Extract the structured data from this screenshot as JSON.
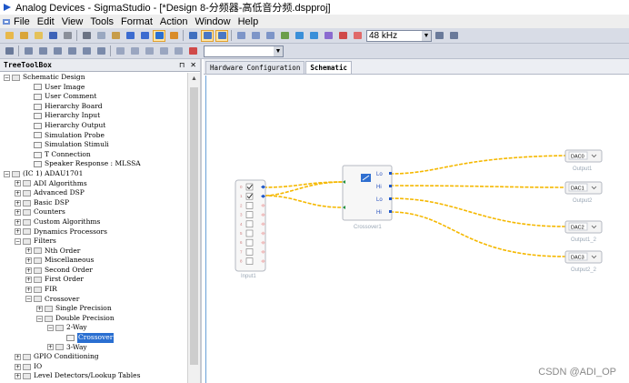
{
  "window": {
    "title": "Analog Devices - SigmaStudio - [*Design 8-分频器-高低音分频.dspproj]"
  },
  "menu": [
    "File",
    "Edit",
    "View",
    "Tools",
    "Format",
    "Action",
    "Window",
    "Help"
  ],
  "toolbar": {
    "sample_rate": "48 kHz"
  },
  "tree_panel": {
    "title": "TreeToolBox",
    "pin_icon": "⊓",
    "close_icon": "✕",
    "items": [
      {
        "label": "Schematic Design",
        "indent": 0,
        "exp": "−",
        "icon": "folder"
      },
      {
        "label": "User Image",
        "indent": 2,
        "exp": "",
        "icon": "item"
      },
      {
        "label": "User Comment",
        "indent": 2,
        "exp": "",
        "icon": "item"
      },
      {
        "label": "Hierarchy Board",
        "indent": 2,
        "exp": "",
        "icon": "item"
      },
      {
        "label": "Hierarchy Input",
        "indent": 2,
        "exp": "",
        "icon": "item"
      },
      {
        "label": "Hierarchy Output",
        "indent": 2,
        "exp": "",
        "icon": "item"
      },
      {
        "label": "Simulation Probe",
        "indent": 2,
        "exp": "",
        "icon": "item"
      },
      {
        "label": "Simulation Stimuli",
        "indent": 2,
        "exp": "",
        "icon": "item"
      },
      {
        "label": "T Connection",
        "indent": 2,
        "exp": "",
        "icon": "item"
      },
      {
        "label": "Speaker Response : MLSSA",
        "indent": 2,
        "exp": "",
        "icon": "item"
      },
      {
        "label": "(IC 1) ADAU1701",
        "indent": 0,
        "exp": "−",
        "icon": "folder"
      },
      {
        "label": "ADI Algorithms",
        "indent": 1,
        "exp": "+",
        "icon": "folder"
      },
      {
        "label": "Advanced DSP",
        "indent": 1,
        "exp": "+",
        "icon": "folder"
      },
      {
        "label": "Basic DSP",
        "indent": 1,
        "exp": "+",
        "icon": "folder"
      },
      {
        "label": "Counters",
        "indent": 1,
        "exp": "+",
        "icon": "folder"
      },
      {
        "label": "Custom Algorithms",
        "indent": 1,
        "exp": "+",
        "icon": "folder"
      },
      {
        "label": "Dynamics Processors",
        "indent": 1,
        "exp": "+",
        "icon": "folder"
      },
      {
        "label": "Filters",
        "indent": 1,
        "exp": "−",
        "icon": "folder"
      },
      {
        "label": "Nth Order",
        "indent": 2,
        "exp": "+",
        "icon": "folder"
      },
      {
        "label": "Miscellaneous",
        "indent": 2,
        "exp": "+",
        "icon": "folder"
      },
      {
        "label": "Second Order",
        "indent": 2,
        "exp": "+",
        "icon": "folder"
      },
      {
        "label": "First Order",
        "indent": 2,
        "exp": "+",
        "icon": "folder"
      },
      {
        "label": "FIR",
        "indent": 2,
        "exp": "+",
        "icon": "folder"
      },
      {
        "label": "Crossover",
        "indent": 2,
        "exp": "−",
        "icon": "folder"
      },
      {
        "label": "Single Precision",
        "indent": 3,
        "exp": "+",
        "icon": "folder"
      },
      {
        "label": "Double Precision",
        "indent": 3,
        "exp": "−",
        "icon": "folder"
      },
      {
        "label": "2-Way",
        "indent": 4,
        "exp": "−",
        "icon": "folder"
      },
      {
        "label": "Crossover",
        "indent": 5,
        "exp": "",
        "icon": "item",
        "selected": true
      },
      {
        "label": "3-Way",
        "indent": 4,
        "exp": "+",
        "icon": "folder"
      },
      {
        "label": "GPIO Conditioning",
        "indent": 1,
        "exp": "+",
        "icon": "folder"
      },
      {
        "label": "IO",
        "indent": 1,
        "exp": "+",
        "icon": "folder"
      },
      {
        "label": "Level Detectors/Lookup Tables",
        "indent": 1,
        "exp": "+",
        "icon": "folder"
      }
    ]
  },
  "tabs": [
    {
      "label": "Hardware Configuration",
      "active": false
    },
    {
      "label": "Schematic",
      "active": true
    }
  ],
  "schematic": {
    "input_block": {
      "label": "Input1",
      "pins": [
        "0",
        "1",
        "2",
        "3",
        "4",
        "5",
        "6",
        "7",
        "8"
      ],
      "checked": [
        true,
        true,
        false,
        false,
        false,
        false,
        false,
        false,
        false
      ]
    },
    "crossover_block": {
      "label": "Crossover1",
      "ports": [
        "Lo",
        "Hi",
        "Lo",
        "Hi"
      ]
    },
    "outputs": [
      {
        "dac": "DAC0",
        "label": "Output1"
      },
      {
        "dac": "DAC1",
        "label": "Output2"
      },
      {
        "dac": "DAC2",
        "label": "Output1_2"
      },
      {
        "dac": "DAC3",
        "label": "Output2_2"
      }
    ]
  },
  "colors": {
    "wire": "#f5b800",
    "port": "#1e56c8",
    "accent": "#2a6fd1"
  },
  "watermark": "CSDN @ADI_OP"
}
